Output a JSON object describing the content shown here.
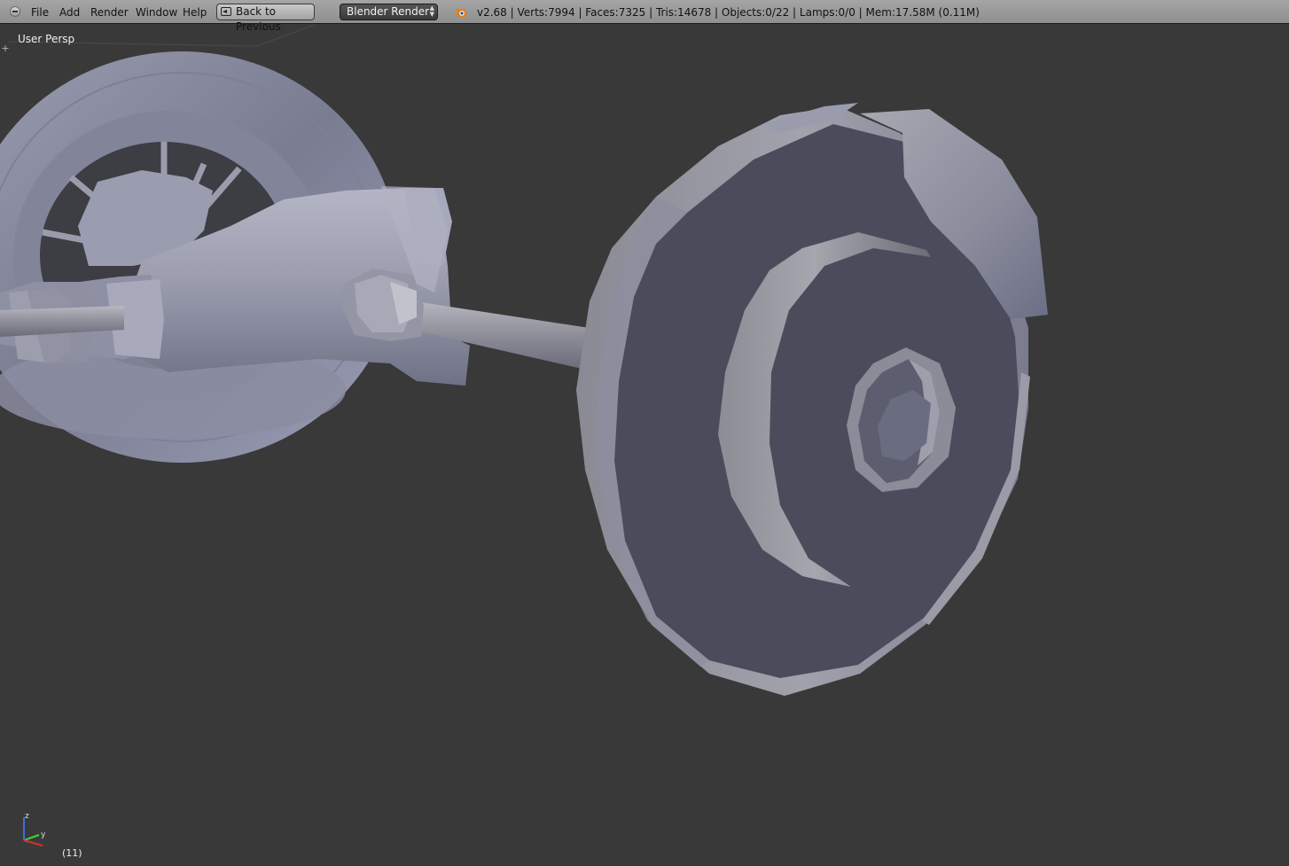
{
  "menu": {
    "items": [
      "File",
      "Add",
      "Render",
      "Window",
      "Help"
    ]
  },
  "header": {
    "back_label": "Back to Previous",
    "render_engine": "Blender Render",
    "stats": "v2.68 | Verts:7994 | Faces:7325 | Tris:14678 | Objects:0/22 | Lamps:0/0 | Mem:17.58M (0.11M)"
  },
  "viewport": {
    "view_name": "User Persp",
    "frame": "(11)",
    "axes": {
      "x": "x",
      "y": "y",
      "z": "z"
    }
  },
  "colors": {
    "background": "#393939",
    "header": "#999999",
    "mesh_face": "#4a4c5c",
    "mesh_rim": "#8e8e98"
  }
}
